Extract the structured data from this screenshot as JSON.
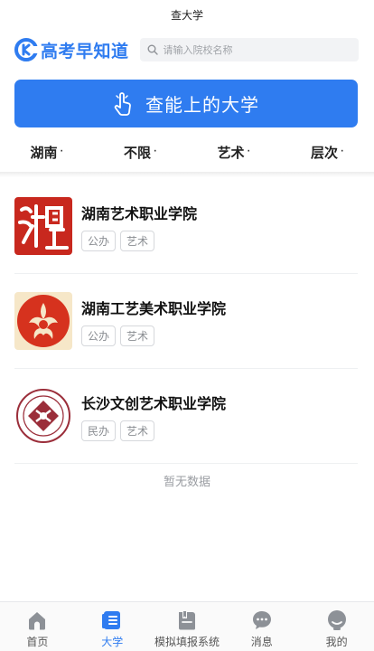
{
  "titlebar": {
    "title": "查大学"
  },
  "header": {
    "brand": "高考早知道",
    "search_placeholder": "请输入院校名称"
  },
  "cta": {
    "label": "查能上的大学",
    "icon": "hand-pointer-icon"
  },
  "filters": [
    {
      "label": "湖南",
      "indicator": "·"
    },
    {
      "label": "不限",
      "indicator": "·"
    },
    {
      "label": "艺术",
      "indicator": "·"
    },
    {
      "label": "层次",
      "indicator": "·"
    }
  ],
  "schools": [
    {
      "name": "湖南艺术职业学院",
      "tags": [
        "公办",
        "艺术"
      ],
      "logo_color": "#c8281e"
    },
    {
      "name": "湖南工艺美术职业学院",
      "tags": [
        "公办",
        "艺术"
      ],
      "logo_color": "#d6321e"
    },
    {
      "name": "长沙文创艺术职业学院",
      "tags": [
        "民办",
        "艺术"
      ],
      "logo_color": "#9b2e3a"
    }
  ],
  "empty_text": "暂无数据",
  "tabbar": {
    "active_color": "#2f7cf0",
    "items": [
      {
        "label": "首页",
        "icon": "home-icon"
      },
      {
        "label": "大学",
        "icon": "list-icon"
      },
      {
        "label": "模拟填报系统",
        "icon": "book-icon"
      },
      {
        "label": "消息",
        "icon": "chat-icon"
      },
      {
        "label": "我的",
        "icon": "user-icon"
      }
    ]
  }
}
